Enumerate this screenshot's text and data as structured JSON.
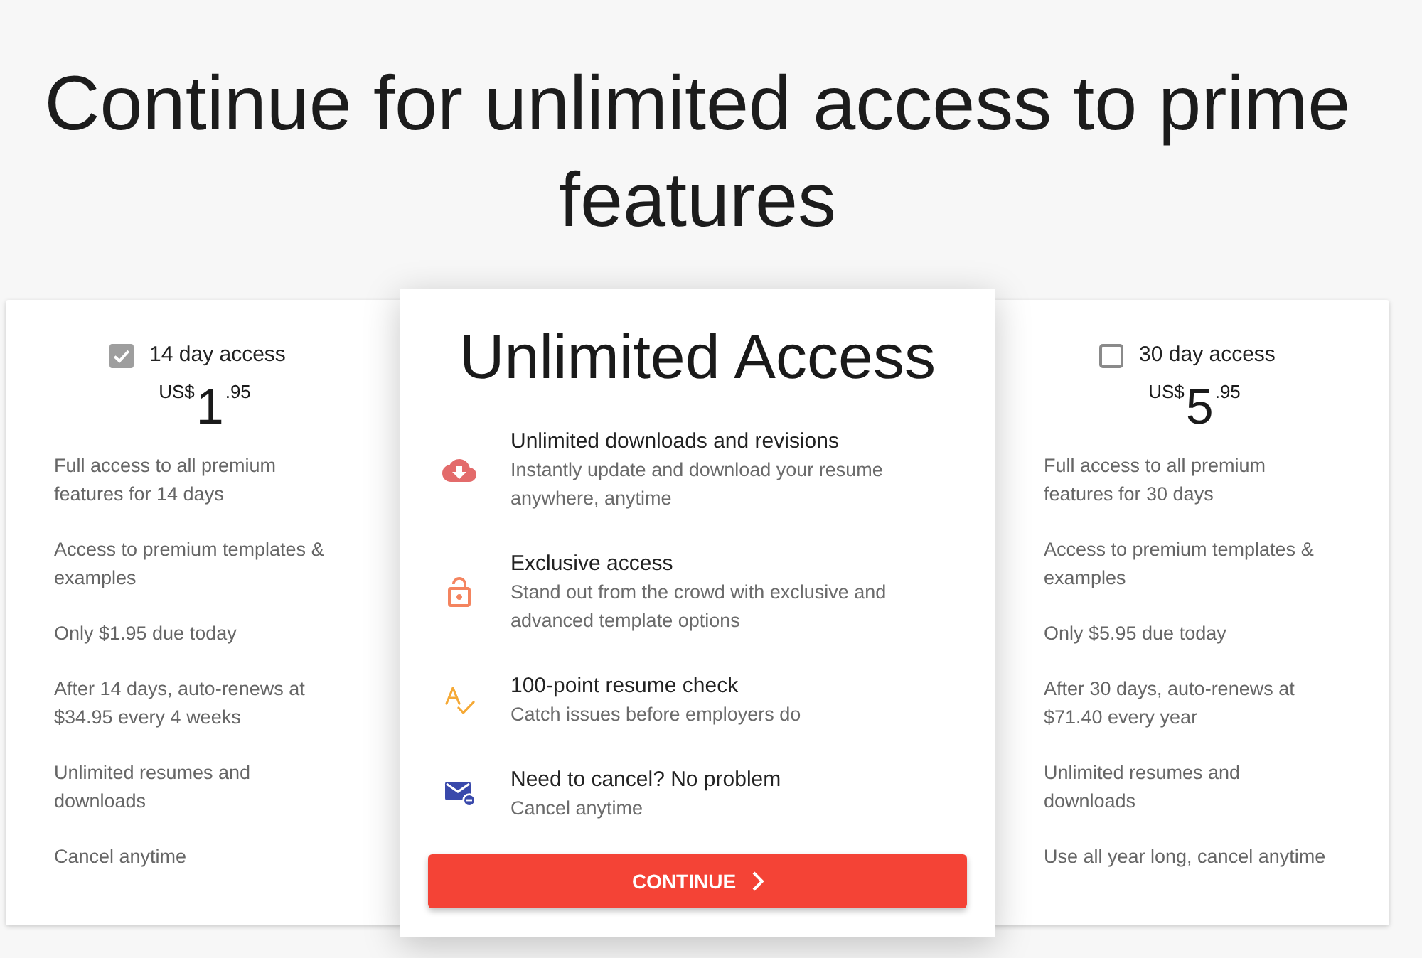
{
  "heading": "Continue for unlimited access to prime features",
  "cards": [
    {
      "kind": "plan",
      "label": "14 day access",
      "selected": true,
      "price": {
        "currency": "US$",
        "whole": "1",
        "cents": ".95"
      },
      "features": [
        "Full access to all premium features for 14 days",
        "Access to premium templates & examples",
        "Only $1.95 due today",
        "After 14 days, auto-renews at $34.95 every 4 weeks",
        "Unlimited resumes and downloads",
        "Cancel anytime"
      ]
    },
    {
      "kind": "featured",
      "title": "Unlimited Access",
      "features": [
        {
          "title": "Unlimited downloads and revisions",
          "description": "Instantly update and download your resume anywhere, anytime"
        },
        {
          "title": "Exclusive access",
          "description": "Stand out from the crowd with exclusive and advanced template options"
        },
        {
          "title": "100-point resume check",
          "description": "Catch issues before employers do"
        },
        {
          "title": "Need to cancel? No problem",
          "description": "Cancel anytime"
        }
      ],
      "button": {
        "label": "CONTINUE"
      }
    },
    {
      "kind": "plan",
      "label": "30 day access",
      "selected": false,
      "price": {
        "currency": "US$",
        "whole": "5",
        "cents": ".95"
      },
      "features": [
        "Full access to all premium features for 30 days",
        "Access to premium templates & examples",
        "Only $5.95 due today",
        "After 30 days, auto-renews at $71.40 every year",
        "Unlimited resumes and downloads",
        "Use all year long, cancel anytime"
      ]
    }
  ]
}
